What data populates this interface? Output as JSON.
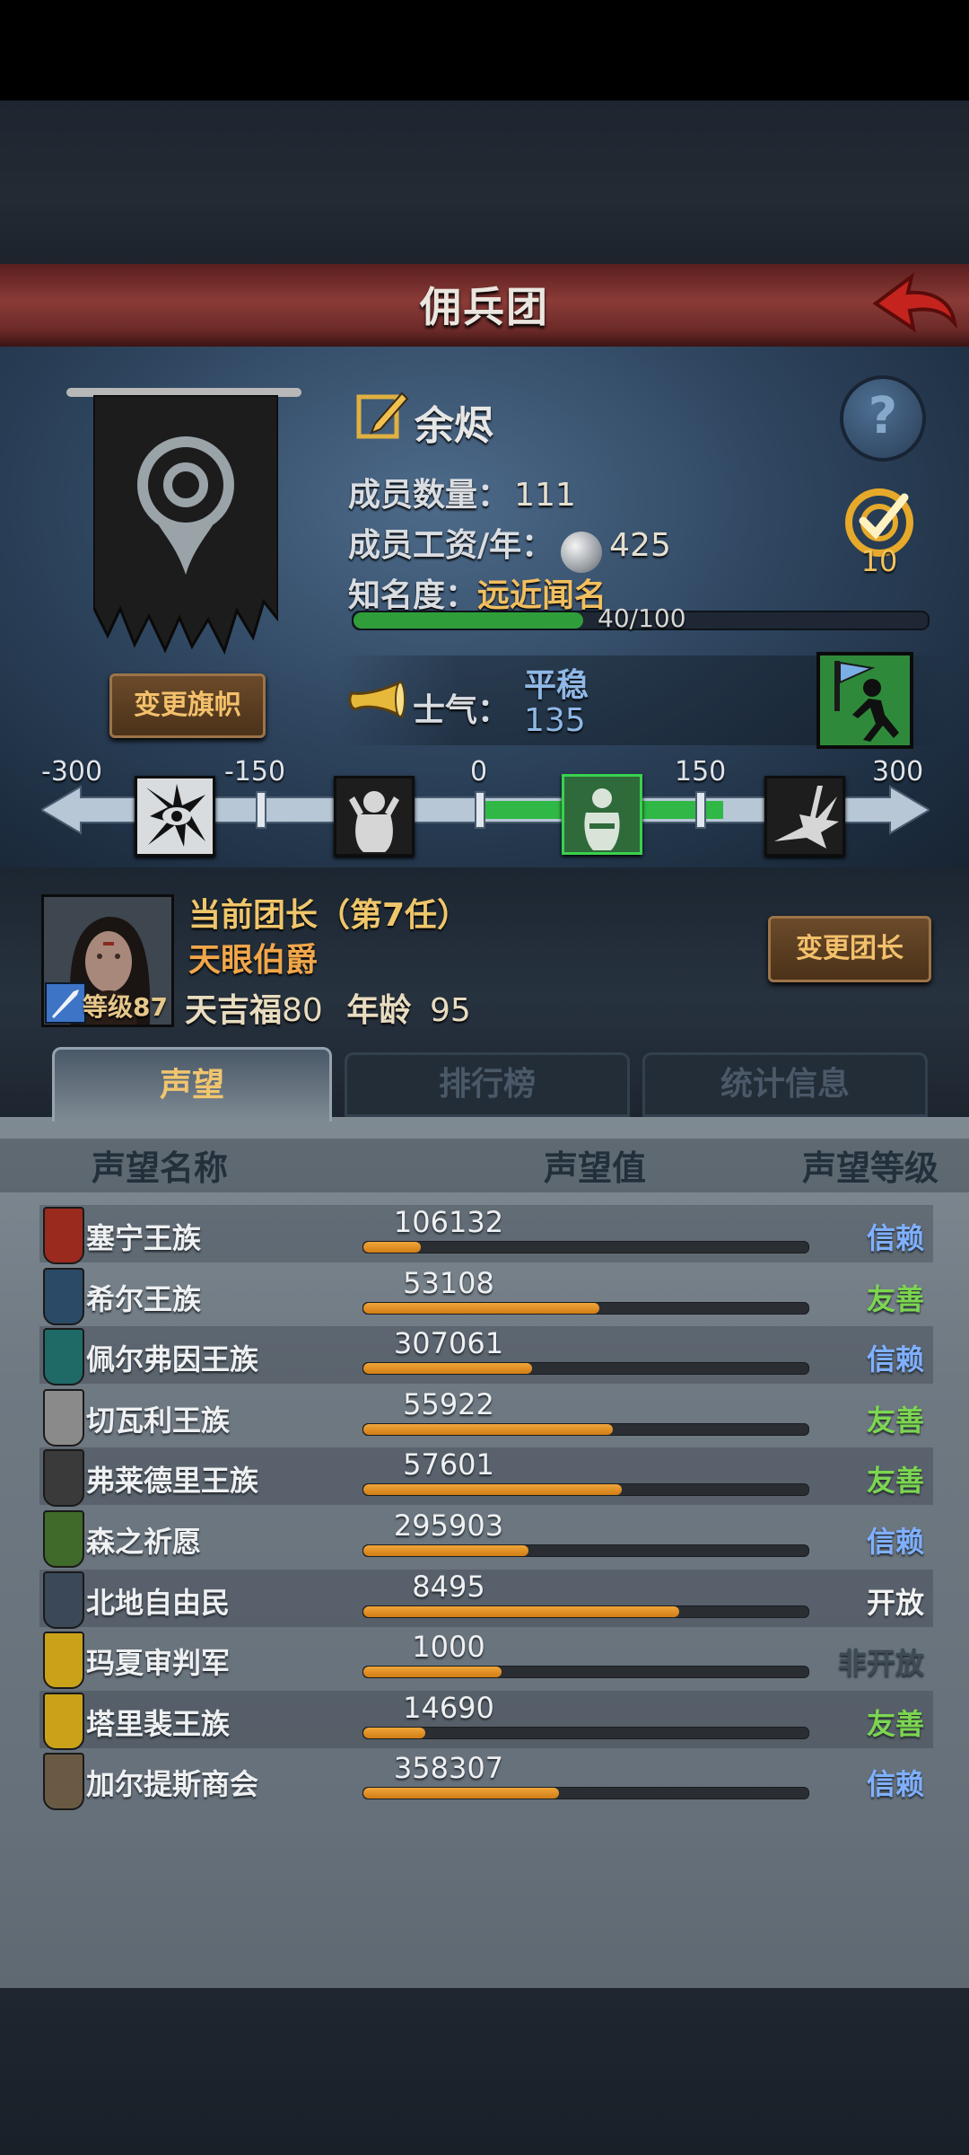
{
  "header": {
    "title": "佣兵团"
  },
  "guild": {
    "name": "余烬",
    "flag_button": "变更旗帜",
    "members_label": "成员数量：",
    "members_value": "111",
    "salary_label": "成员工资/年：",
    "salary_value": "425",
    "fame_label": "知名度：",
    "fame_value": "远近闻名",
    "fame_progress_text": "40/100",
    "fame_progress": 0.4,
    "target_count": "10"
  },
  "morale": {
    "label": "士气：",
    "status": "平稳",
    "value": "135",
    "scale_ticks": [
      "-300",
      "-150",
      "0",
      "150",
      "300"
    ]
  },
  "leader": {
    "heading": "当前团长（第7任）",
    "title": "天眼伯爵",
    "level_text": "等级87",
    "trait_name": "天吉福",
    "trait_value": "80",
    "age_label": "年龄",
    "age_value": "95",
    "change_button": "变更团长"
  },
  "tabs": [
    {
      "label": "声望",
      "active": true
    },
    {
      "label": "排行榜",
      "active": false
    },
    {
      "label": "统计信息",
      "active": false
    }
  ],
  "reputation": {
    "headers": {
      "name": "声望名称",
      "value": "声望值",
      "level": "声望等级"
    },
    "rows": [
      {
        "name": "塞宁王族",
        "value": "106132",
        "progress": 0.13,
        "level": "信赖",
        "level_color": "#7fb0ff",
        "icon_color": "#9a2a1e"
      },
      {
        "name": "希尔王族",
        "value": "53108",
        "progress": 0.53,
        "level": "友善",
        "level_color": "#7cd650",
        "icon_color": "#2a4a66"
      },
      {
        "name": "佩尔弗因王族",
        "value": "307061",
        "progress": 0.38,
        "level": "信赖",
        "level_color": "#7fb0ff",
        "icon_color": "#1f6a66"
      },
      {
        "name": "切瓦利王族",
        "value": "55922",
        "progress": 0.56,
        "level": "友善",
        "level_color": "#7cd650",
        "icon_color": "#8a8a8a"
      },
      {
        "name": "弗莱德里王族",
        "value": "57601",
        "progress": 0.58,
        "level": "友善",
        "level_color": "#7cd650",
        "icon_color": "#3a3a3a"
      },
      {
        "name": "森之祈愿",
        "value": "295903",
        "progress": 0.37,
        "level": "信赖",
        "level_color": "#7fb0ff",
        "icon_color": "#3f6a2a"
      },
      {
        "name": "北地自由民",
        "value": "8495",
        "progress": 0.71,
        "level": "开放",
        "level_color": "#f2f2f2",
        "icon_color": "#3a4858"
      },
      {
        "name": "玛夏审判军",
        "value": "1000",
        "progress": 0.31,
        "level": "非开放",
        "level_color": "#3e4a56",
        "icon_color": "#c9a21a"
      },
      {
        "name": "塔里裴王族",
        "value": "14690",
        "progress": 0.14,
        "level": "友善",
        "level_color": "#7cd650",
        "icon_color": "#c9a21a"
      },
      {
        "name": "加尔提斯商会",
        "value": "358307",
        "progress": 0.44,
        "level": "信赖",
        "level_color": "#7fb0ff",
        "icon_color": "#6a5a44"
      }
    ]
  }
}
